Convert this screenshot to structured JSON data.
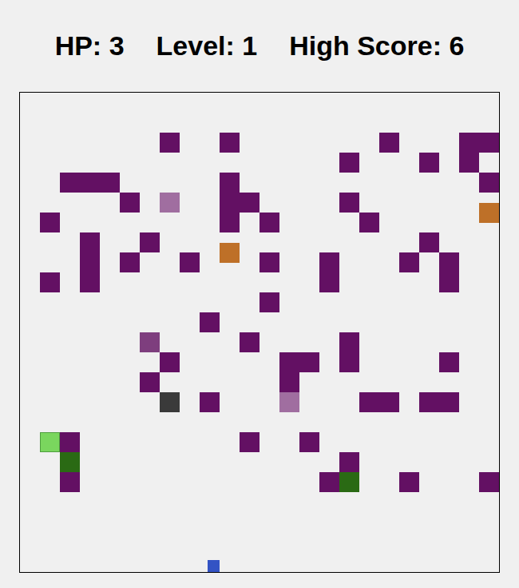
{
  "hud": [
    "HP: 3",
    "Level: 1",
    "High Score: 6"
  ],
  "board": {
    "cols": 24,
    "rows": 24,
    "cells": [
      {
        "kind": "wall",
        "col": 7,
        "row": 2
      },
      {
        "kind": "wall",
        "col": 10,
        "row": 2
      },
      {
        "kind": "wall",
        "col": 18,
        "row": 2
      },
      {
        "kind": "wall",
        "col": 22,
        "row": 2
      },
      {
        "kind": "wall",
        "col": 23,
        "row": 2
      },
      {
        "kind": "wall",
        "col": 16,
        "row": 3
      },
      {
        "kind": "wall",
        "col": 20,
        "row": 3
      },
      {
        "kind": "wall",
        "col": 22,
        "row": 3
      },
      {
        "kind": "wall",
        "col": 2,
        "row": 4
      },
      {
        "kind": "wall",
        "col": 3,
        "row": 4
      },
      {
        "kind": "wall",
        "col": 4,
        "row": 4
      },
      {
        "kind": "wall",
        "col": 10,
        "row": 4
      },
      {
        "kind": "wall",
        "col": 23,
        "row": 4
      },
      {
        "kind": "wall",
        "col": 5,
        "row": 5
      },
      {
        "kind": "faded",
        "col": 7,
        "row": 5
      },
      {
        "kind": "wall",
        "col": 10,
        "row": 5
      },
      {
        "kind": "wall",
        "col": 11,
        "row": 5
      },
      {
        "kind": "wall",
        "col": 16,
        "row": 5
      },
      {
        "kind": "orange",
        "col": 23,
        "row": 5.5
      },
      {
        "kind": "wall",
        "col": 1,
        "row": 6
      },
      {
        "kind": "wall",
        "col": 10,
        "row": 6
      },
      {
        "kind": "wall",
        "col": 12,
        "row": 6
      },
      {
        "kind": "wall",
        "col": 17,
        "row": 6
      },
      {
        "kind": "wall",
        "col": 3,
        "row": 7
      },
      {
        "kind": "wall",
        "col": 6,
        "row": 7
      },
      {
        "kind": "wall",
        "col": 20,
        "row": 7
      },
      {
        "kind": "orange",
        "col": 10,
        "row": 7.5
      },
      {
        "kind": "wall",
        "col": 3,
        "row": 8
      },
      {
        "kind": "wall",
        "col": 5,
        "row": 8
      },
      {
        "kind": "wall",
        "col": 8,
        "row": 8
      },
      {
        "kind": "wall",
        "col": 12,
        "row": 8
      },
      {
        "kind": "wall",
        "col": 15,
        "row": 8
      },
      {
        "kind": "wall",
        "col": 19,
        "row": 8
      },
      {
        "kind": "wall",
        "col": 21,
        "row": 8
      },
      {
        "kind": "wall",
        "col": 1,
        "row": 9
      },
      {
        "kind": "wall",
        "col": 3,
        "row": 9
      },
      {
        "kind": "wall",
        "col": 15,
        "row": 9
      },
      {
        "kind": "wall",
        "col": 21,
        "row": 9
      },
      {
        "kind": "wall",
        "col": 12,
        "row": 10
      },
      {
        "kind": "wall",
        "col": 9,
        "row": 11
      },
      {
        "kind": "medium",
        "col": 6,
        "row": 12
      },
      {
        "kind": "wall",
        "col": 11,
        "row": 12
      },
      {
        "kind": "wall",
        "col": 16,
        "row": 12
      },
      {
        "kind": "wall",
        "col": 7,
        "row": 13
      },
      {
        "kind": "wall",
        "col": 13,
        "row": 13
      },
      {
        "kind": "wall",
        "col": 14,
        "row": 13
      },
      {
        "kind": "wall",
        "col": 16,
        "row": 13
      },
      {
        "kind": "wall",
        "col": 21,
        "row": 13
      },
      {
        "kind": "wall",
        "col": 6,
        "row": 14
      },
      {
        "kind": "wall",
        "col": 13,
        "row": 14
      },
      {
        "kind": "dark",
        "col": 7,
        "row": 15
      },
      {
        "kind": "wall",
        "col": 9,
        "row": 15
      },
      {
        "kind": "faded",
        "col": 13,
        "row": 15
      },
      {
        "kind": "wall",
        "col": 17,
        "row": 15
      },
      {
        "kind": "wall",
        "col": 18,
        "row": 15
      },
      {
        "kind": "wall",
        "col": 20,
        "row": 15
      },
      {
        "kind": "wall",
        "col": 21,
        "row": 15
      },
      {
        "kind": "head",
        "col": 1,
        "row": 17
      },
      {
        "kind": "wall",
        "col": 2,
        "row": 17
      },
      {
        "kind": "wall",
        "col": 11,
        "row": 17
      },
      {
        "kind": "wall",
        "col": 14,
        "row": 17
      },
      {
        "kind": "green",
        "col": 2,
        "row": 18
      },
      {
        "kind": "wall",
        "col": 16,
        "row": 18
      },
      {
        "kind": "wall",
        "col": 2,
        "row": 19
      },
      {
        "kind": "wall",
        "col": 15,
        "row": 19
      },
      {
        "kind": "green",
        "col": 16,
        "row": 19
      },
      {
        "kind": "wall",
        "col": 19,
        "row": 19
      },
      {
        "kind": "wall",
        "col": 23,
        "row": 19
      },
      {
        "kind": "player",
        "col": 9.4,
        "row": 23.4
      }
    ]
  }
}
